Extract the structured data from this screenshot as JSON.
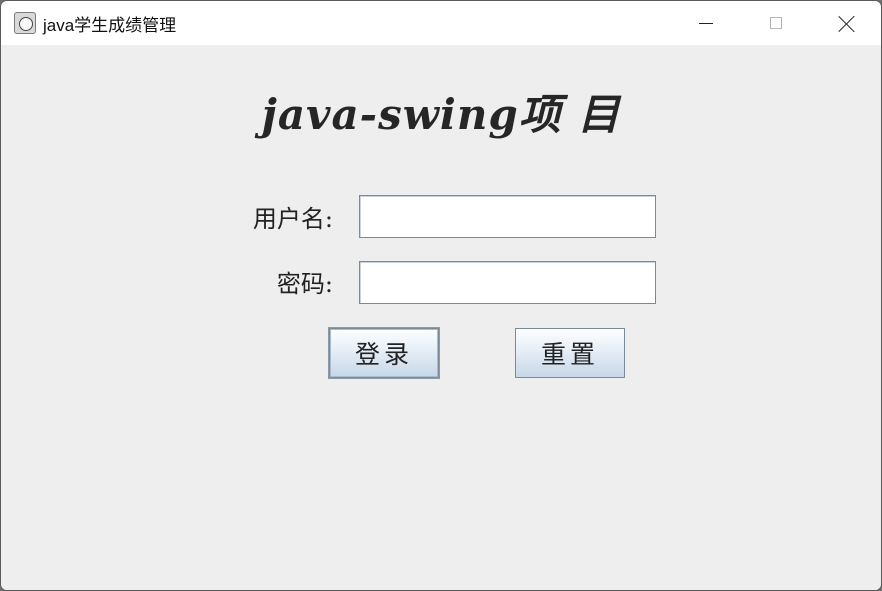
{
  "window": {
    "title": "java学生成绩管理",
    "icon": "app-icon",
    "controls": [
      "minimize-icon",
      "maximize-icon",
      "close-icon"
    ]
  },
  "form": {
    "heading": "java-swing项 目",
    "username_label": "用户名:",
    "username_value": "",
    "password_label": "密码:",
    "password_value": "",
    "login_button": "登录",
    "reset_button": "重置"
  },
  "colors": {
    "window_background": "#eeeeee",
    "titlebar_background": "#ffffff",
    "button_gradient_top": "#fdfeff",
    "button_gradient_bottom": "#c6d7e8",
    "field_border": "#7a8a99"
  }
}
